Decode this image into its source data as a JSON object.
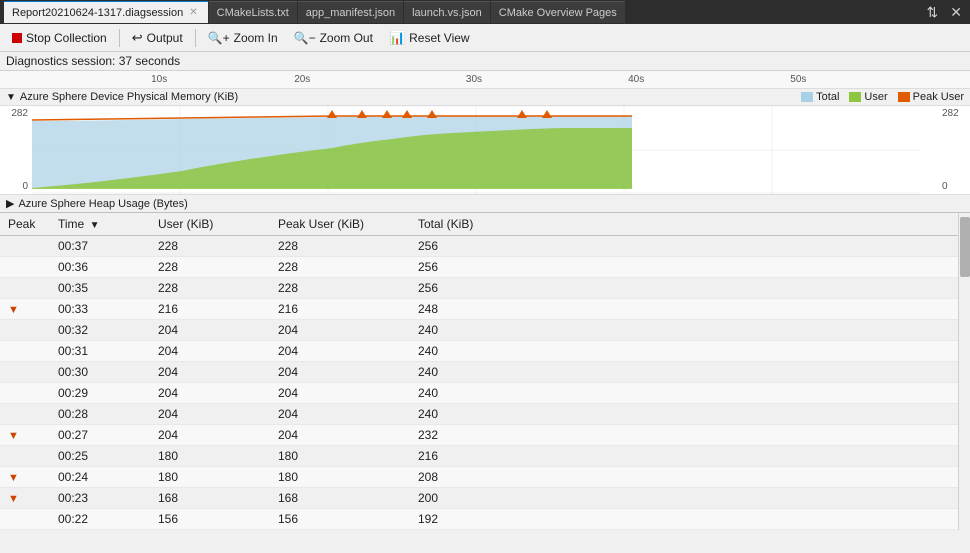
{
  "tabs": [
    {
      "id": "diag",
      "label": "Report20210624-1317.diagsession",
      "active": true,
      "closable": true
    },
    {
      "id": "cmake",
      "label": "CMakeLists.txt",
      "active": false,
      "closable": false
    },
    {
      "id": "manifest",
      "label": "app_manifest.json",
      "active": false,
      "closable": false
    },
    {
      "id": "launch",
      "label": "launch.vs.json",
      "active": false,
      "closable": false
    },
    {
      "id": "overview",
      "label": "CMake Overview Pages",
      "active": false,
      "closable": false
    }
  ],
  "toolbar": {
    "stop_label": "Stop Collection",
    "output_label": "Output",
    "zoom_in_label": "Zoom In",
    "zoom_out_label": "Zoom Out",
    "reset_view_label": "Reset View"
  },
  "session": {
    "label": "Diagnostics session:",
    "duration": "37 seconds"
  },
  "timeline": {
    "labels": [
      "10s",
      "20s",
      "30s",
      "40s",
      "50s"
    ]
  },
  "physical_memory": {
    "title": "Azure Sphere Device Physical Memory (KiB)",
    "y_max": "282",
    "y_min": "0",
    "legend": [
      {
        "label": "Total",
        "color": "#a8d0e6"
      },
      {
        "label": "User",
        "color": "#8dc63f"
      },
      {
        "label": "Peak User",
        "color": "#e05a00"
      }
    ]
  },
  "heap_usage": {
    "title": "Azure Sphere Heap Usage (Bytes)"
  },
  "table": {
    "columns": [
      "Peak",
      "Time",
      "User (KiB)",
      "Peak User (KiB)",
      "Total (KiB)"
    ],
    "sort_col": "Time",
    "sort_dir": "desc",
    "rows": [
      {
        "peak": false,
        "time": "00:37",
        "user": 228,
        "peak_user": 228,
        "total": 256
      },
      {
        "peak": false,
        "time": "00:36",
        "user": 228,
        "peak_user": 228,
        "total": 256
      },
      {
        "peak": false,
        "time": "00:35",
        "user": 228,
        "peak_user": 228,
        "total": 256
      },
      {
        "peak": true,
        "time": "00:33",
        "user": 216,
        "peak_user": 216,
        "total": 248
      },
      {
        "peak": false,
        "time": "00:32",
        "user": 204,
        "peak_user": 204,
        "total": 240
      },
      {
        "peak": false,
        "time": "00:31",
        "user": 204,
        "peak_user": 204,
        "total": 240
      },
      {
        "peak": false,
        "time": "00:30",
        "user": 204,
        "peak_user": 204,
        "total": 240
      },
      {
        "peak": false,
        "time": "00:29",
        "user": 204,
        "peak_user": 204,
        "total": 240
      },
      {
        "peak": false,
        "time": "00:28",
        "user": 204,
        "peak_user": 204,
        "total": 240
      },
      {
        "peak": true,
        "time": "00:27",
        "user": 204,
        "peak_user": 204,
        "total": 232
      },
      {
        "peak": false,
        "time": "00:25",
        "user": 180,
        "peak_user": 180,
        "total": 216
      },
      {
        "peak": true,
        "time": "00:24",
        "user": 180,
        "peak_user": 180,
        "total": 208
      },
      {
        "peak": true,
        "time": "00:23",
        "user": 168,
        "peak_user": 168,
        "total": 200
      },
      {
        "peak": false,
        "time": "00:22",
        "user": 156,
        "peak_user": 156,
        "total": 192
      }
    ]
  },
  "colors": {
    "accent": "#0078d4",
    "tab_active_bg": "#f0f0f0",
    "tab_inactive_bg": "#3c3c3c",
    "peak_marker_color": "#cc4400",
    "chart_total": "#a8d0e6",
    "chart_user": "#8dc63f",
    "chart_peak": "#e05a00"
  }
}
